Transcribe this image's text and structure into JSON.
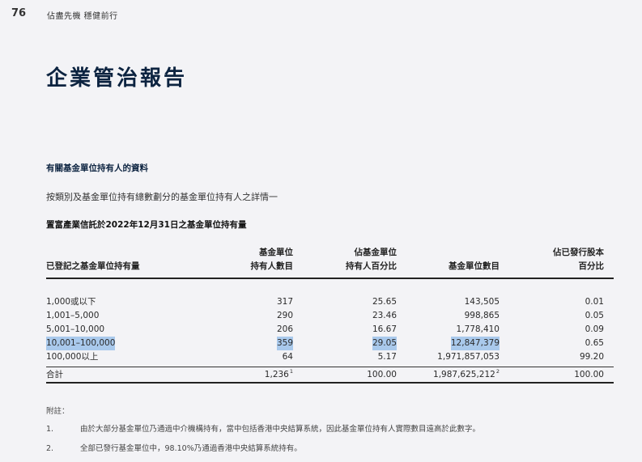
{
  "header": {
    "page_number": "76",
    "tagline": "佔盡先機  穩健前行"
  },
  "title": "企業管治報告",
  "section": {
    "heading": "有關基金單位持有人的資料",
    "intro": "按類別及基金單位持有總數劃分的基金單位持有人之詳情一",
    "table_caption": "置富產業信託於2022年12月31日之基金單位持有量"
  },
  "table": {
    "headers": {
      "range": "已登記之基金單位持有量",
      "holders_line1": "基金單位",
      "holders_line2": "持有人數目",
      "holders_pct_line1": "佔基金單位",
      "holders_pct_line2": "持有人百分比",
      "units": "基金單位數目",
      "issued_pct_line1": "佔已發行股本",
      "issued_pct_line2": "百分比"
    },
    "rows": [
      {
        "range": "1,000或以下",
        "holders": "317",
        "holders_pct": "25.65",
        "units": "143,505",
        "issued_pct": "0.01"
      },
      {
        "range": "1,001–5,000",
        "holders": "290",
        "holders_pct": "23.46",
        "units": "998,865",
        "issued_pct": "0.05"
      },
      {
        "range": "5,001–10,000",
        "holders": "206",
        "holders_pct": "16.67",
        "units": "1,778,410",
        "issued_pct": "0.09"
      },
      {
        "range": "10,001–100,000",
        "holders": "359",
        "holders_pct": "29.05",
        "units": "12,847,379",
        "issued_pct": "0.65"
      },
      {
        "range": "100,000以上",
        "holders": "64",
        "holders_pct": "5.17",
        "units": "1,971,857,053",
        "issued_pct": "99.20"
      }
    ],
    "total": {
      "label": "合計",
      "holders": "1,236",
      "holders_sup": "1",
      "holders_pct": "100.00",
      "units": "1,987,625,212",
      "units_sup": "2",
      "issued_pct": "100.00"
    }
  },
  "notes": {
    "label": "附註：",
    "items": [
      {
        "num": "1.",
        "text": "由於大部分基金單位乃通過中介機構持有，當中包括香港中央結算系統，因此基金單位持有人實際數目遠高於此數字。"
      },
      {
        "num": "2.",
        "text": "全部已發行基金單位中，98.10%乃通過香港中央結算系統持有。"
      }
    ]
  },
  "colors": {
    "title": "#0c2340",
    "highlight": "#a9c9ec",
    "background": "#f3f3f6"
  }
}
